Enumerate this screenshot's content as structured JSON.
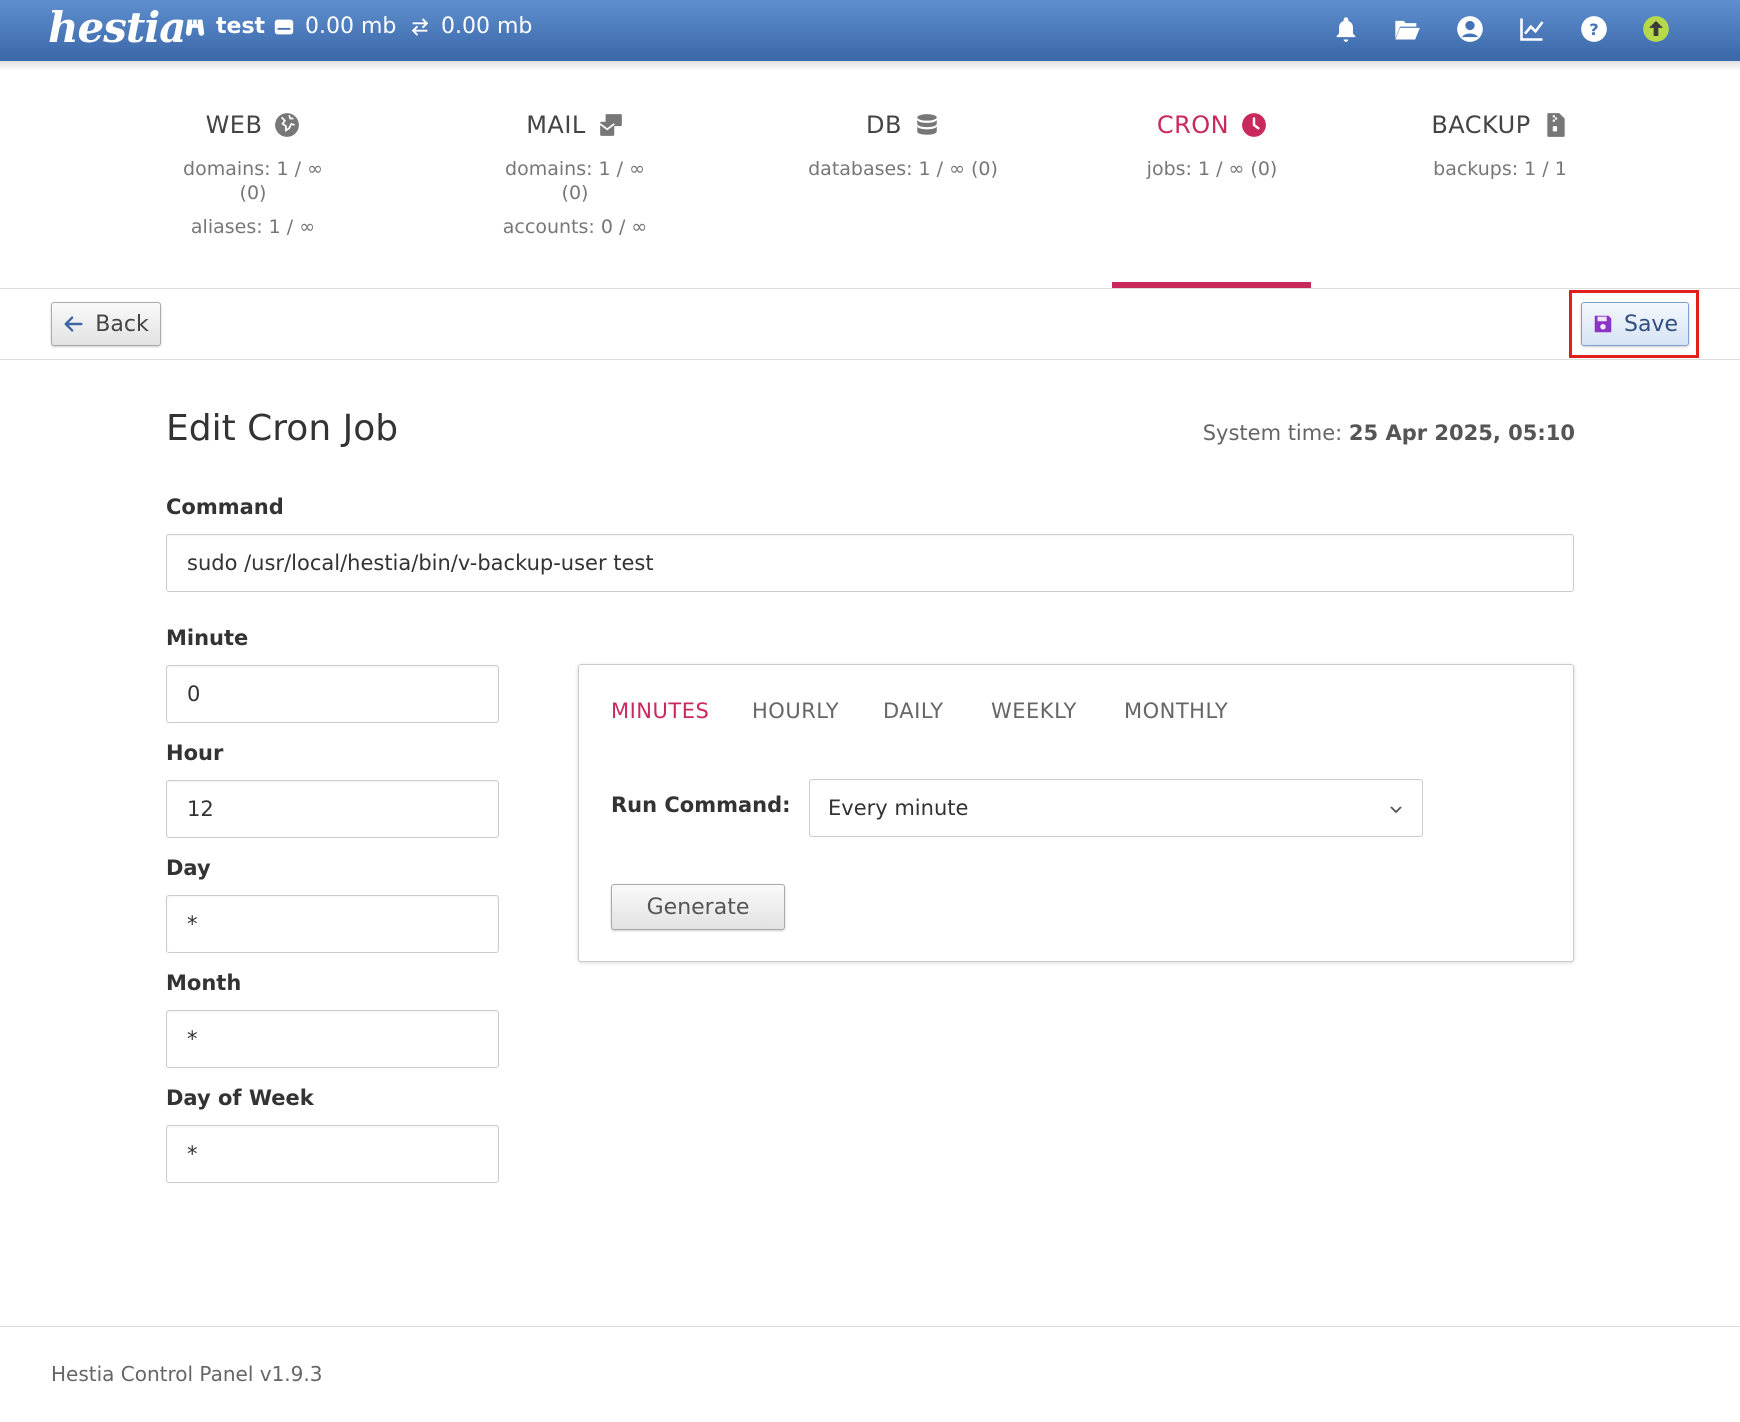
{
  "topbar": {
    "logo": "hestia",
    "user": "test",
    "disk": "0.00 mb",
    "bandwidth": "0.00 mb"
  },
  "nav": {
    "web": {
      "title": "WEB",
      "line1": "domains: 1 / ∞ (0)",
      "line2": "aliases: 1 / ∞"
    },
    "mail": {
      "title": "MAIL",
      "line1": "domains: 1 / ∞ (0)",
      "line2": "accounts: 0 / ∞"
    },
    "db": {
      "title": "DB",
      "line1": "databases: 1 / ∞ (0)"
    },
    "cron": {
      "title": "CRON",
      "line1": "jobs: 1 / ∞ (0)"
    },
    "backup": {
      "title": "BACKUP",
      "line1": "backups: 1 / 1"
    },
    "active": "cron",
    "accent_color": "#c9295b"
  },
  "toolbar": {
    "back_label": "Back",
    "save_label": "Save"
  },
  "form": {
    "title": "Edit Cron Job",
    "system_time_label": "System time:",
    "system_time_value": "25 Apr 2025, 05:10",
    "command_label": "Command",
    "command_value": "sudo /usr/local/hestia/bin/v-backup-user test",
    "minute_label": "Minute",
    "minute_value": "0",
    "hour_label": "Hour",
    "hour_value": "12",
    "day_label": "Day",
    "day_value": "*",
    "month_label": "Month",
    "month_value": "*",
    "dow_label": "Day of Week",
    "dow_value": "*"
  },
  "generator": {
    "tabs": [
      "MINUTES",
      "HOURLY",
      "DAILY",
      "WEEKLY",
      "MONTHLY"
    ],
    "active_tab": "MINUTES",
    "run_label": "Run Command:",
    "run_value": "Every minute",
    "generate_label": "Generate"
  },
  "footer": {
    "text": "Hestia Control Panel v1.9.3"
  },
  "icons": [
    "binoculars-icon",
    "hdd-icon",
    "transfer-icon",
    "bell-icon",
    "folder-open-icon",
    "user-circle-icon",
    "chart-line-icon",
    "help-icon",
    "update-icon",
    "globe-icon",
    "mail-bulk-icon",
    "database-icon",
    "clock-icon",
    "file-archive-icon",
    "arrow-left-icon",
    "floppy-icon",
    "chevron-down-icon"
  ]
}
